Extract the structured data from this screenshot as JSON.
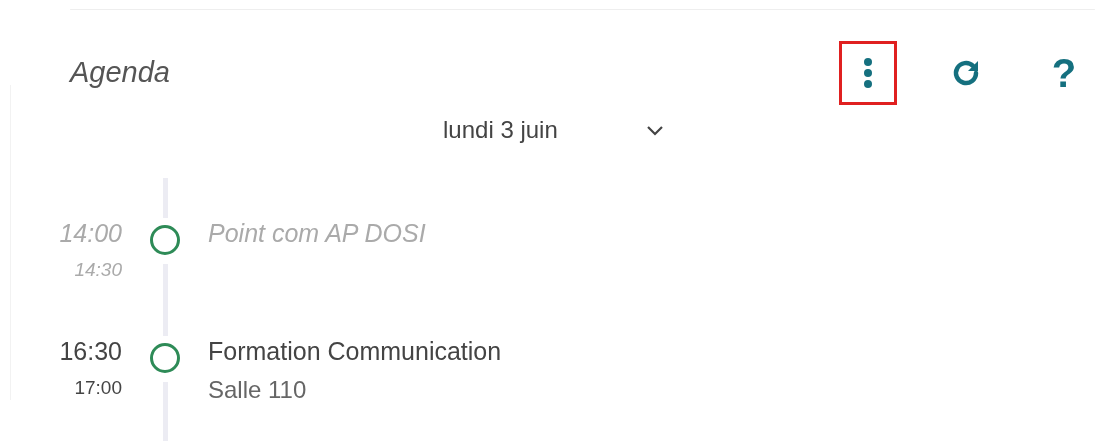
{
  "header": {
    "title": "Agenda",
    "actions": [
      {
        "kind": "more",
        "highlighted": true
      },
      {
        "kind": "refresh",
        "highlighted": false
      },
      {
        "kind": "help",
        "glyph": "?",
        "highlighted": false
      }
    ]
  },
  "date_selector": {
    "value": "lundi 3 juin"
  },
  "events": [
    {
      "start": "14:00",
      "end": "14:30",
      "title": "Point com AP DOSI",
      "past": true
    },
    {
      "start": "16:30",
      "end": "17:00",
      "title": "Formation Communication",
      "location": "Salle 110",
      "past": false
    }
  ]
}
